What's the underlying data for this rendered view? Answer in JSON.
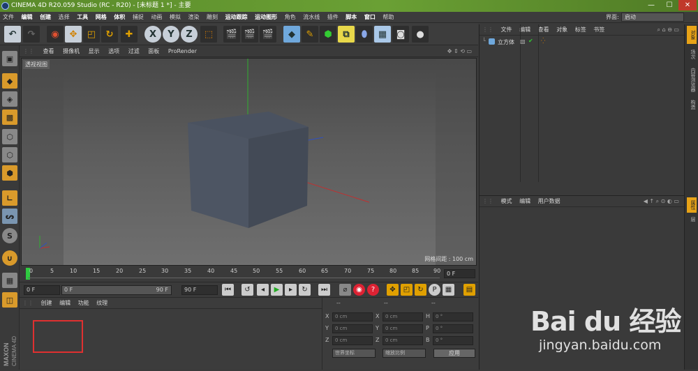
{
  "window": {
    "title": "CINEMA 4D R20.059 Studio (RC - R20) - [未标题 1 *] - 主要",
    "min": "—",
    "max": "☐",
    "close": "✕"
  },
  "menubar": {
    "items": [
      "文件",
      "编辑",
      "创建",
      "选择",
      "工具",
      "网格",
      "体积",
      "捕捉",
      "动画",
      "模拟",
      "渲染",
      "雕刻",
      "运动跟踪",
      "运动图形",
      "角色",
      "流水线",
      "插件",
      "脚本",
      "窗口",
      "帮助"
    ],
    "layout_label": "界面:",
    "layout_value": "启动"
  },
  "toolbar": {
    "undo": "↶",
    "redo": "↷",
    "axes": [
      "X",
      "Y",
      "Z"
    ]
  },
  "viewport_menu": {
    "items": [
      "查看",
      "摄像机",
      "显示",
      "选项",
      "过滤",
      "面板",
      "ProRender"
    ],
    "view_label": "透视视图",
    "grid_spacing": "网格间距 : 100 cm"
  },
  "timeline": {
    "ticks": [
      "0",
      "5",
      "10",
      "15",
      "20",
      "25",
      "30",
      "35",
      "40",
      "45",
      "50",
      "55",
      "60",
      "65",
      "70",
      "75",
      "80",
      "85",
      "90"
    ],
    "current_frame": "0 F"
  },
  "transport": {
    "start": "0 F",
    "range_start": "0 F",
    "range_end": "90 F",
    "end": "90 F"
  },
  "material_manager": {
    "menu": [
      "创建",
      "编辑",
      "功能",
      "纹理"
    ]
  },
  "coordinates": {
    "headers": [
      "--",
      "--",
      "--"
    ],
    "rows": [
      {
        "l1": "X",
        "v1": "0 cm",
        "l2": "X",
        "v2": "0 cm",
        "l3": "H",
        "v3": "0 °"
      },
      {
        "l1": "Y",
        "v1": "0 cm",
        "l2": "Y",
        "v2": "0 cm",
        "l3": "P",
        "v3": "0 °"
      },
      {
        "l1": "Z",
        "v1": "0 cm",
        "l2": "Z",
        "v2": "0 cm",
        "l3": "B",
        "v3": "0 °"
      }
    ],
    "mode_world": "世界坐标",
    "mode_scale": "缩放比例",
    "apply": "应用"
  },
  "object_manager": {
    "menu": [
      "文件",
      "编辑",
      "查看",
      "对象",
      "标签",
      "书签"
    ],
    "objects": [
      {
        "name": "立方体"
      }
    ]
  },
  "attribute_manager": {
    "menu": [
      "模式",
      "编辑",
      "用户数据"
    ]
  },
  "right_tabs": [
    "对象",
    "场次",
    "内容浏览器",
    "构造",
    "属性",
    "层"
  ],
  "maxon": {
    "brand": "MAXON",
    "product": "CINEMA 4D"
  },
  "watermark": {
    "main": "Bai du 经验",
    "sub": "jingyan.baidu.com"
  },
  "colors": {
    "accent": "#e8a317",
    "title_green": "#6aa034",
    "axis_x": "#c03030",
    "axis_y": "#30b030",
    "axis_z": "#3050c0",
    "selection_box": "#e03030"
  }
}
